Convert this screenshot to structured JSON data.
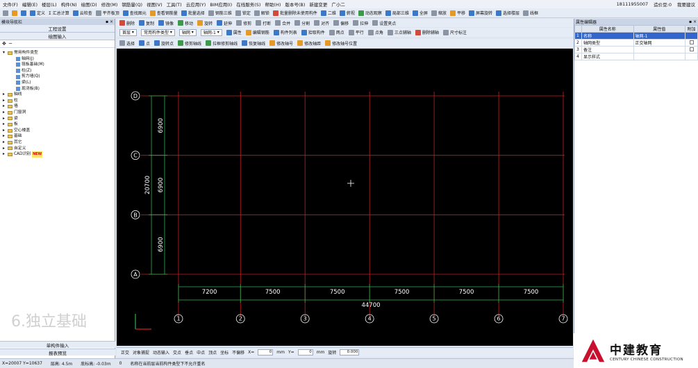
{
  "menu": {
    "items": [
      "文件(F)",
      "编辑(E)",
      "楼层(L)",
      "构件(N)",
      "绘图(D)",
      "修改(M)",
      "钢筋量(Q)",
      "视图(V)",
      "工具(T)",
      "云应用(Y)",
      "BIM应用(I)",
      "在线服务(S)",
      "帮助(H)",
      "版本号(B)",
      "新建变更",
      "广小二"
    ],
    "phone": "18111955007",
    "points": "造价豆:0",
    "suggest": "我要建议"
  },
  "toolbar1": [
    "定义",
    "Σ 汇总计算",
    "云检查",
    "平齐板顶",
    "查找图元",
    "查看钢筋量",
    "批量选择",
    "钢筋三维",
    "锁定",
    "解锁",
    "批量删除未使用构件",
    "二维",
    "俯视",
    "动态观察",
    "局部三维",
    "全屏",
    "缩放",
    "平移",
    "屏幕旋转",
    "选择楼层",
    "线框"
  ],
  "toolbar2": [
    "删除",
    "复制",
    "镜像",
    "移动",
    "旋转",
    "延伸",
    "修剪",
    "打断",
    "合并",
    "分割",
    "对齐",
    "偏移",
    "拉伸",
    "设置夹点"
  ],
  "toolbar3": {
    "floor": "首层",
    "category": "常用构件类型",
    "type": "轴网",
    "name": "轴网-1",
    "buttons": [
      "属性",
      "编辑钢筋",
      "构件列表",
      "拾取构件",
      "两点",
      "平行",
      "点角",
      "三点辅轴",
      "删除辅轴",
      "尺寸标注"
    ]
  },
  "toolbar4": [
    "选择",
    "点",
    "旋转点",
    "修剪轴线",
    "拉框修剪轴线",
    "恢复轴线",
    "修改轴号",
    "修改轴距",
    "修改轴号位置"
  ],
  "leftPanel": {
    "title": "模块导航栏",
    "btnTop1": "工程设置",
    "btnTop2": "绘图输入",
    "tree": [
      {
        "label": "常用构件类型",
        "level": 0,
        "folder": true
      },
      {
        "label": "轴网(J)",
        "level": 1
      },
      {
        "label": "筏板基础(M)",
        "level": 1
      },
      {
        "label": "柱(Z)",
        "level": 1
      },
      {
        "label": "剪力墙(Q)",
        "level": 1
      },
      {
        "label": "梁(L)",
        "level": 1
      },
      {
        "label": "现浇板(B)",
        "level": 1
      },
      {
        "label": "轴线",
        "level": 0,
        "folder": true
      },
      {
        "label": "柱",
        "level": 0,
        "folder": true
      },
      {
        "label": "墙",
        "level": 0,
        "folder": true
      },
      {
        "label": "门窗洞",
        "level": 0,
        "folder": true
      },
      {
        "label": "梁",
        "level": 0,
        "folder": true
      },
      {
        "label": "板",
        "level": 0,
        "folder": true
      },
      {
        "label": "空心楼盖",
        "level": 0,
        "folder": true
      },
      {
        "label": "基础",
        "level": 0,
        "folder": true
      },
      {
        "label": "其它",
        "level": 0,
        "folder": true
      },
      {
        "label": "自定义",
        "level": 0,
        "folder": true
      },
      {
        "label": "CAD识别",
        "level": 0,
        "folder": true,
        "badge": "NEW"
      }
    ],
    "btnBottom1": "单构件输入",
    "btnBottom2": "报表预览"
  },
  "rightPanel": {
    "title": "属性编辑器",
    "headers": [
      "属性名称",
      "属性值",
      "附加"
    ],
    "rows": [
      {
        "no": "1",
        "name": "名称",
        "value": "轴网-1",
        "selected": true
      },
      {
        "no": "2",
        "name": "轴网类型",
        "value": "正交轴网"
      },
      {
        "no": "3",
        "name": "备注",
        "value": ""
      },
      {
        "no": "4",
        "name": "显示样式",
        "value": ""
      }
    ]
  },
  "grid": {
    "xLabels": [
      "1",
      "2",
      "3",
      "4",
      "5",
      "6",
      "7"
    ],
    "xSpacings": [
      "7200",
      "7500",
      "7500",
      "7500",
      "7500",
      "7500"
    ],
    "xTotal": "44700",
    "yLabels": [
      "A",
      "B",
      "C",
      "D"
    ],
    "ySpacings": [
      "6900",
      "6900",
      "6900"
    ],
    "yTotal": "20700"
  },
  "watermark": "6.独立基础",
  "statusbar": {
    "items": [
      "正交",
      "对象捕捉",
      "动态输入",
      "交点",
      "垂点",
      "中点",
      "顶点",
      "坐标",
      "不偏移"
    ],
    "xLabel": "X=",
    "xValue": "0",
    "mm1": "mm",
    "yLabel": "Y=",
    "yValue": "0",
    "mm2": "mm",
    "rotate": "旋转",
    "rotateValue": "0.000"
  },
  "bottom": {
    "coords": "X=20007  Y=10637",
    "floorHeight": "层高: 4.5m",
    "bottomElev": "底标高: -0.03m",
    "zero": "0",
    "message": "名称在当前层当前构件类型下不允许重名"
  },
  "logo": {
    "cn": "中建教育",
    "en": "CENTURY CHINESE CONSTRUCTION"
  },
  "colors": {
    "gridRed": "#c81e1e",
    "dimGreen": "#2fb34a",
    "canvasBg": "#000000"
  }
}
